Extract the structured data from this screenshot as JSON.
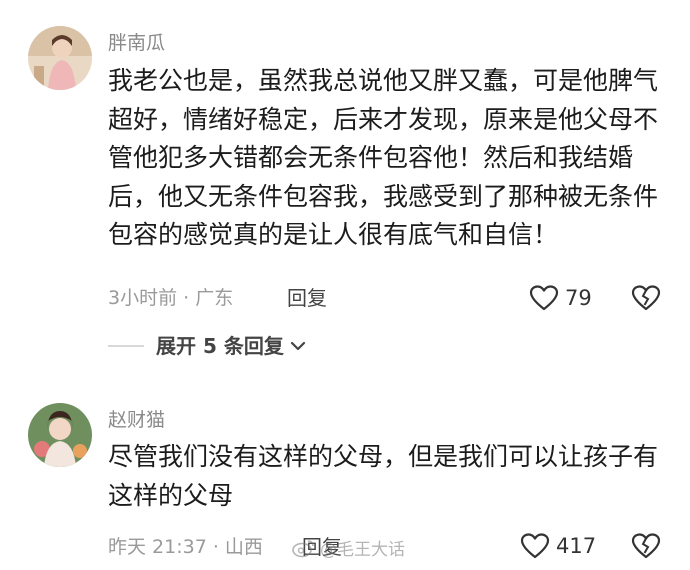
{
  "comments": [
    {
      "username": "胖南瓜",
      "text": "我老公也是，虽然我总说他又胖又蠢，可是他脾气超好，情绪好稳定，后来才发现，原来是他父母不管他犯多大错都会无条件包容他！然后和我结婚后，他又无条件包容我，我感受到了那种被无条件包容的感觉真的是让人很有底气和自信！",
      "meta": "3小时前 · 广东",
      "reply_label": "回复",
      "likes": "79",
      "expand_label": "展开 5 条回复"
    },
    {
      "username": "赵财猫",
      "text": "尽管我们没有这样的父母，但是我们可以让孩子有这样的父母",
      "meta": "昨天 21:37 · 山西",
      "reply_label": "回复",
      "likes": "417"
    }
  ],
  "watermark": "@毛王大话",
  "icons": {
    "like": "heart-outline-icon",
    "dislike": "broken-heart-icon",
    "expand": "chevron-down-icon",
    "watermark": "weibo-icon"
  }
}
